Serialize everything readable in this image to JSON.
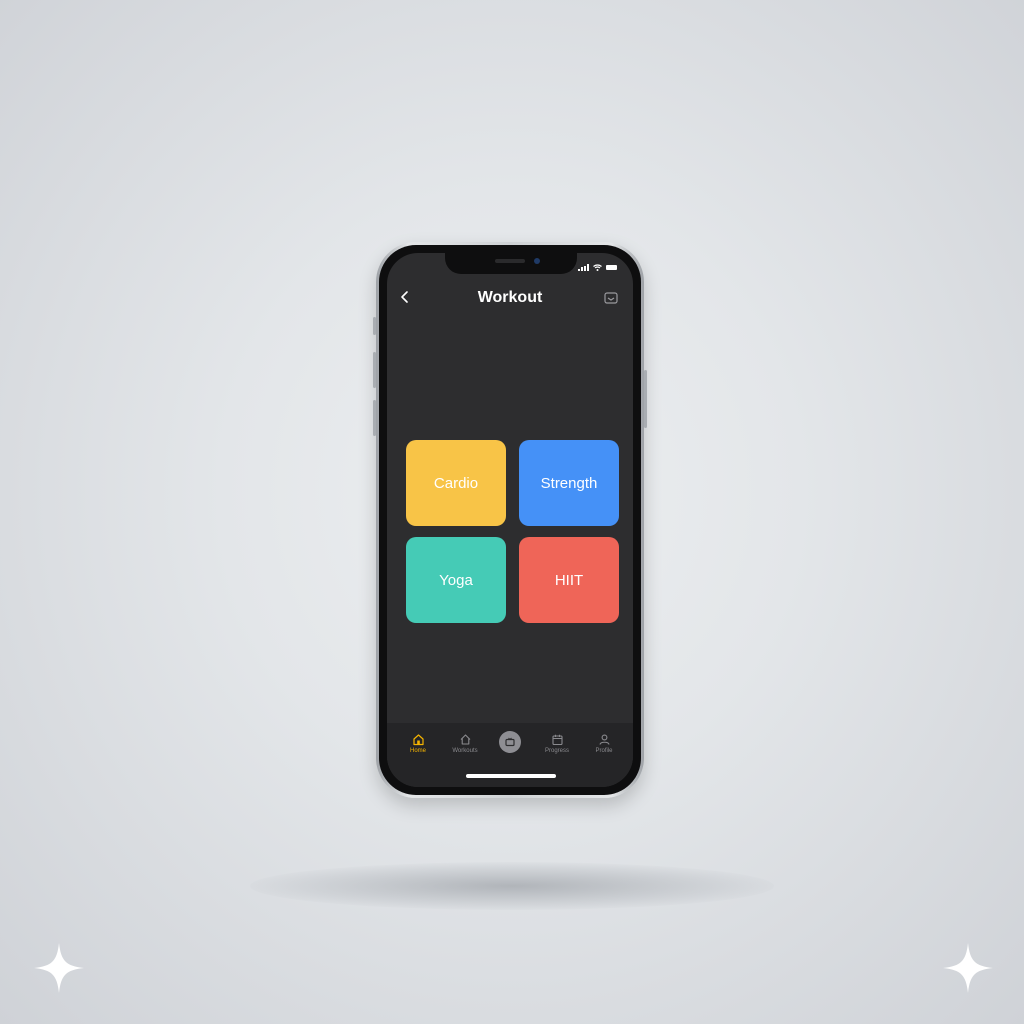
{
  "header": {
    "title": "Workout",
    "back_icon": "chevron-left-icon",
    "action_icon": "inbox-icon"
  },
  "categories": [
    {
      "label": "Cardio",
      "color": "#f8c447"
    },
    {
      "label": "Strength",
      "color": "#4591f7"
    },
    {
      "label": "Yoga",
      "color": "#45cbb6"
    },
    {
      "label": "HIIT",
      "color": "#ef6558"
    }
  ],
  "tab_bar": {
    "items": [
      {
        "label": "Home",
        "icon": "home-icon",
        "active": true
      },
      {
        "label": "Workouts",
        "icon": "house-icon",
        "active": false
      },
      {
        "label": "",
        "icon": "tv-icon",
        "active": false
      },
      {
        "label": "Progress",
        "icon": "calendar-icon",
        "active": false
      },
      {
        "label": "Profile",
        "icon": "user-icon",
        "active": false
      }
    ],
    "active_color": "#f5b400",
    "inactive_color": "#8a8a8e"
  },
  "status_bar": {
    "icons": [
      "signal-icon",
      "wifi-icon",
      "battery-icon"
    ]
  }
}
